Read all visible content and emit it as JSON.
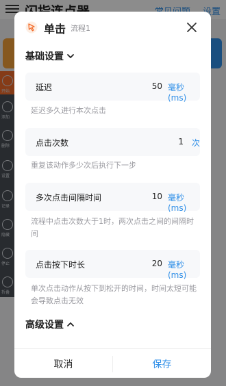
{
  "background_app": {
    "title": "闪指连点器",
    "faq_link": "常见问题",
    "settings_link": "设置",
    "sidebar_labels": [
      "开始",
      "添加",
      "删除",
      "设置",
      "记录",
      "隐藏",
      "停止",
      "折叠"
    ]
  },
  "dialog": {
    "title": "单击",
    "subtitle": "流程1",
    "basic_section": "基础设置",
    "advanced_section": "高级设置",
    "settings": [
      {
        "label": "延迟",
        "value": "50",
        "unit": "毫秒(ms)",
        "description": "延迟多久进行本次点击"
      },
      {
        "label": "点击次数",
        "value": "1",
        "unit": "次",
        "description": "重复该动作多少次后执行下一步"
      },
      {
        "label": "多次点击间隔时间",
        "value": "10",
        "unit": "毫秒(ms)",
        "description": "流程中点击次数大于1时，两次点击之间的间隔时间"
      },
      {
        "label": "点击按下时长",
        "value": "20",
        "unit": "毫秒(ms)",
        "description": "单次点击动作从按下到松开的时间，时间太短可能会导致点击无效"
      }
    ],
    "cancel_label": "取消",
    "save_label": "保存"
  },
  "colors": {
    "accent": "#2f8fe8",
    "brand_orange": "#f36c2b",
    "overlay": "rgba(0,0,0,0.45)"
  },
  "icons": {
    "dialog_icon": "cursor-tap-icon",
    "close": "close-icon",
    "basic_toggle": "chevron-down-icon",
    "advanced_toggle": "chevron-up-icon"
  }
}
